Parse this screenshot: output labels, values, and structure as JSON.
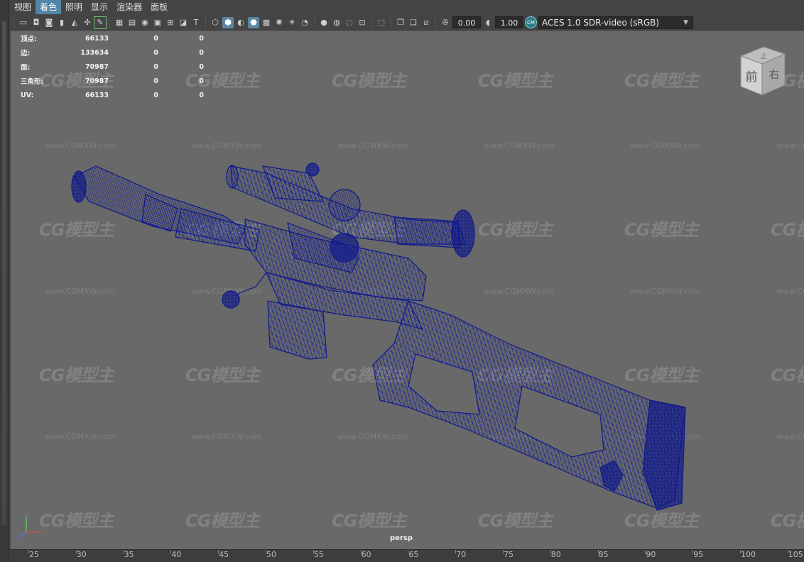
{
  "menu": [
    "视图",
    "着色",
    "照明",
    "显示",
    "渲染器",
    "面板"
  ],
  "menu_active_index": 1,
  "toolbar": {
    "exposure_value": "0.00",
    "gamma_value": "1.00",
    "colorspace": "ACES 1.0 SDR-video (sRGB)",
    "icons": [
      "camera-icon",
      "camera-lock-icon",
      "camera-attr-icon",
      "bookmark-icon",
      "image-plane-icon",
      "pivot-icon",
      "pencil-icon",
      "grid-icon",
      "film-gate-icon",
      "resolution-gate-icon",
      "gate-mask-icon",
      "field-chart-icon",
      "safe-action-icon",
      "safe-title-icon",
      "wireframe-icon",
      "smooth-shade-icon",
      "default-material-icon",
      "wireframe-on-shaded-icon",
      "xray-icon",
      "textured-icon",
      "use-lights-icon",
      "shadows-icon",
      "screen-space-ao-icon",
      "motion-blur-icon",
      "multisample-aa-icon",
      "depth-of-field-icon",
      "isolate-select-icon",
      "xray-joints-icon",
      "xray-active-icon",
      "backface-icon",
      "exposure-icon",
      "gamma-icon",
      "color-management-icon"
    ]
  },
  "stats": [
    {
      "label": "顶点:",
      "v1": "66133",
      "v2": "0",
      "v3": "0"
    },
    {
      "label": "边:",
      "v1": "133634",
      "v2": "0",
      "v3": "0"
    },
    {
      "label": "面:",
      "v1": "70987",
      "v2": "0",
      "v3": "0"
    },
    {
      "label": "三角形:",
      "v1": "70987",
      "v2": "0",
      "v3": "0"
    },
    {
      "label": "UV:",
      "v1": "66133",
      "v2": "0",
      "v3": "0"
    }
  ],
  "viewcube": {
    "front": "前",
    "right": "右",
    "top": "上"
  },
  "camera": "persp",
  "axis": {
    "y": "y",
    "x": "x",
    "z": "z"
  },
  "watermark": {
    "logo": "CG模型主",
    "url": "www.CGMXW.com"
  },
  "ruler_ticks": [
    "25",
    "30",
    "35",
    "40",
    "45",
    "50",
    "55",
    "60",
    "65",
    "70",
    "75",
    "80",
    "85",
    "90",
    "95",
    "100",
    "105"
  ],
  "colors": {
    "viewport_bg": "#696969",
    "wireframe": "#0f1a8c",
    "menu_active": "#5285a6"
  }
}
